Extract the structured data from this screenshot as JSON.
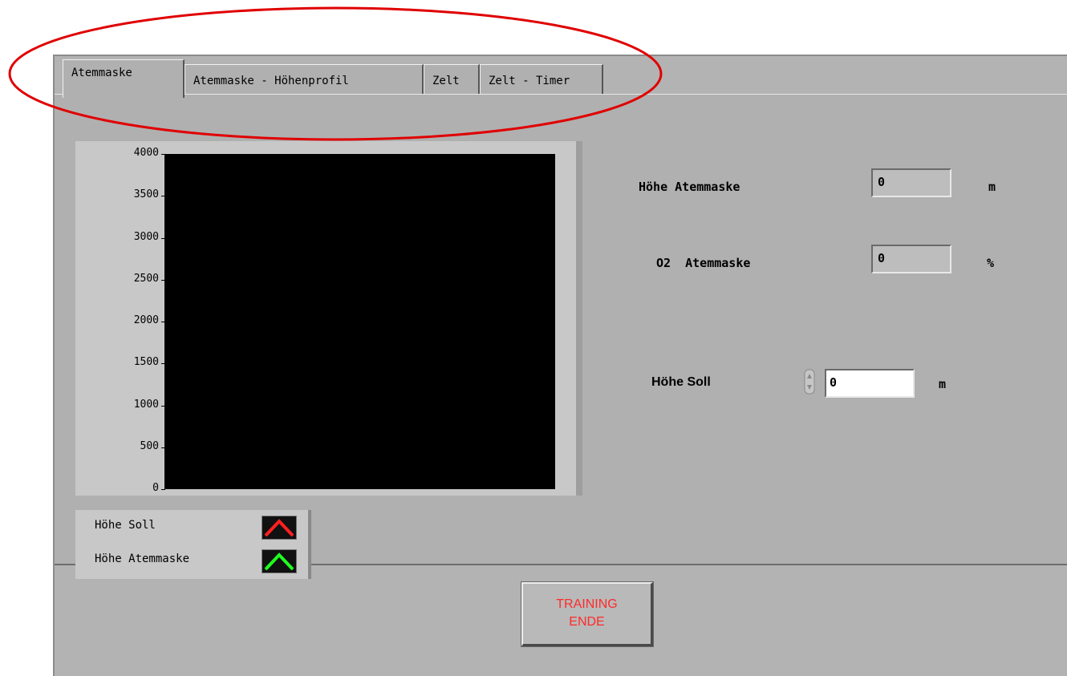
{
  "tabs": [
    {
      "label": "Atemmaske",
      "active": true
    },
    {
      "label": "Atemmaske - Höhenprofil",
      "active": false
    },
    {
      "label": "Zelt",
      "active": false
    },
    {
      "label": "Zelt - Timer",
      "active": false
    }
  ],
  "chart_data": {
    "type": "line",
    "title": "",
    "ylim": [
      0,
      4000
    ],
    "yticks": [
      "4000",
      "3500",
      "3000",
      "2500",
      "2000",
      "1500",
      "1000",
      "500",
      "0"
    ],
    "series": [
      {
        "name": "Höhe Soll",
        "color": "#ff2020",
        "values": []
      },
      {
        "name": "Höhe Atemmaske",
        "color": "#20ff20",
        "values": []
      }
    ],
    "plot_background": "#000000"
  },
  "fields": {
    "hoehe_atemmaske": {
      "label": "Höhe Atemmaske",
      "value": "0",
      "unit": "m"
    },
    "o2_atemmaske": {
      "label": "O2  Atemmaske",
      "value": "0",
      "unit": "%"
    },
    "hoehe_soll": {
      "label": "Höhe Soll",
      "value": "0",
      "unit": "m"
    }
  },
  "end_button": {
    "line1": "TRAINING",
    "line2": "ENDE",
    "color": "#ff2a2a"
  },
  "annotation_color": "#e00000"
}
